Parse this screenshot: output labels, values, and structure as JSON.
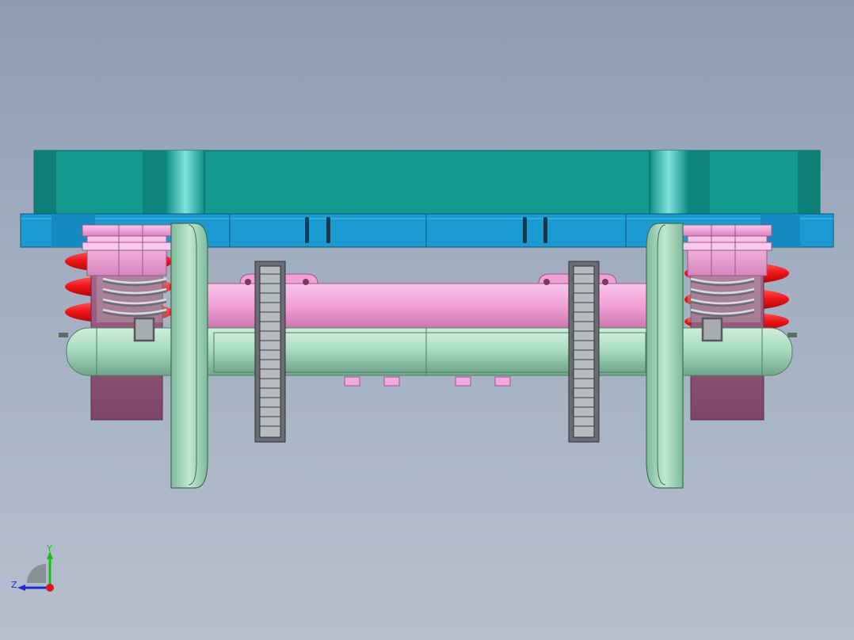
{
  "view": {
    "background_top": "#8d9cb0",
    "background_bottom": "#b6bfcd"
  },
  "model": {
    "parts": {
      "frame_top_color": "#13998f",
      "frame_base_color": "#1a9ad0",
      "axle_tube_color": "#f29fd6",
      "axle_shaft_color": "#a8dcbf",
      "wheel_color": "#a5d9bb",
      "bearing_color": "#f4a8e0",
      "housing_color": "#9c5c82",
      "spring_red_color": "#ee1313",
      "spring_steel_color": "#c7c9cc",
      "gear_color": "#b8bcc0"
    }
  },
  "triad": {
    "y_label": "Y",
    "z_label": "Z",
    "y_color": "#18c018",
    "z_color": "#1d2dd6",
    "origin_color": "#e01818"
  }
}
